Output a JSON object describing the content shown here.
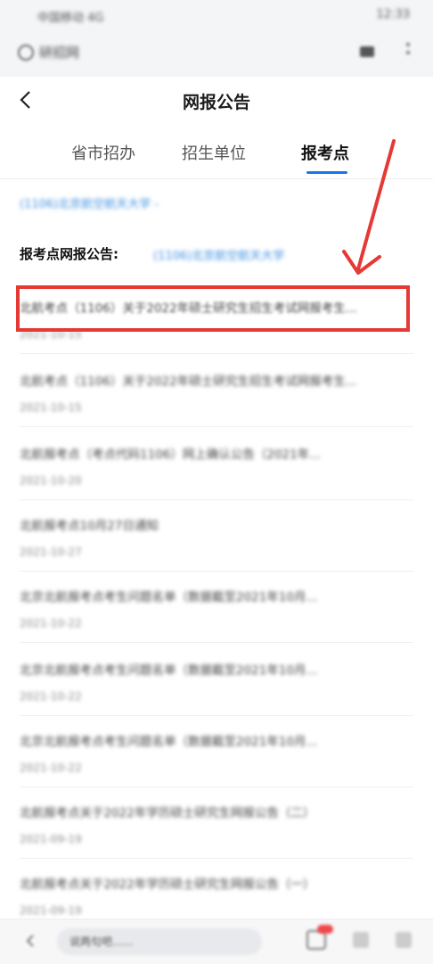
{
  "status_bar": {
    "left": "中国移动 4G",
    "right": "12:33"
  },
  "browser_bar": {
    "search_text": "研招网"
  },
  "header": {
    "title": "网报公告"
  },
  "tabs": [
    {
      "label": "省市招办"
    },
    {
      "label": "招生单位"
    },
    {
      "label": "报考点"
    }
  ],
  "breadcrumb": "(1106)北京航空航天大学 -",
  "section": {
    "heading": "报考点网报公告:",
    "link": "(1106)北京航空航天大学"
  },
  "list": [
    {
      "title": "北航考点（1106）关于2022年硕士研究生招生考试网报考生...",
      "date": "2021-10-15"
    },
    {
      "title": "北航考点（1106）关于2022年硕士研究生招生考试网报考生...",
      "date": "2021-10-15"
    },
    {
      "title": "北航报考点（考点代码1106）网上确认公告（2021年...",
      "date": "2021-10-20"
    },
    {
      "title": "北航报考点10月27日通知",
      "date": "2021-10-27"
    },
    {
      "title": "北京北航报考点考生问题名单（数据截至2021年10月...",
      "date": "2021-10-22"
    },
    {
      "title": "北京北航报考点考生问题名单（数据截至2021年10月...",
      "date": "2021-10-22"
    },
    {
      "title": "北京北航报考点考生问题名单（数据截至2021年10月...",
      "date": "2021-10-22"
    },
    {
      "title": "北航报考点关于2022年学历硕士研究生网报公告（二）",
      "date": "2021-09-19"
    },
    {
      "title": "北航报考点关于2022年学历硕士研究生网报公告（一）",
      "date": "2021-09-19"
    }
  ],
  "bottom_bar": {
    "input_placeholder": "说两句吧……"
  },
  "colors": {
    "accent": "#1677e6",
    "highlight": "#e53935",
    "link": "#3b8ee0"
  }
}
